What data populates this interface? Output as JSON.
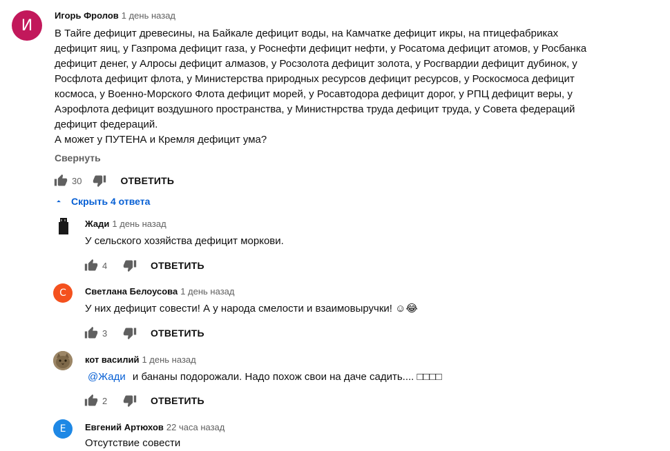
{
  "main_comment": {
    "avatar_letter": "И",
    "avatar_color": "#c2185b",
    "author": "Игорь Фролов",
    "time": "1 день назад",
    "text_lines": [
      "В Тайге дефицит древесины, на Байкале дефицит воды, на Камчатке дефицит икры, на птицефабриках",
      "дефицит яиц, у Газпрома дефицит газа, у Роснефти дефицит нефти, у Росатома дефицит атомов, у Росбанка",
      "дефицит денег, у Алросы дефицит алмазов, у Росзолота дефицит золота, у Росгвардии дефицит дубинок, у",
      "Росфлота дефицит флота, у Министерства природных ресурсов дефицит ресурсов, у Роскосмоса дефицит",
      "космоса, у Военно-Морского Флота дефицит морей, у Росавтодора дефицит дорог, у РПЦ дефицит веры, у",
      "Аэрофлота дефицит воздушного пространства, у Министнрства труда дефицит труда, у Совета федераций",
      "дефицит федераций.",
      "А может у ПУТЕНА и Кремля дефицит ума?"
    ],
    "collapse_label": "Свернуть",
    "likes": "30",
    "reply_label": "ОТВЕТИТЬ"
  },
  "replies_toggle": {
    "label": "Скрыть 4 ответа",
    "icon": "chevron-up-icon"
  },
  "replies": [
    {
      "avatar_type": "image",
      "author": "Жади",
      "time": "1 день назад",
      "mention": "",
      "text": "У сельского хозяйства дефицит моркови.",
      "likes": "4",
      "reply_label": "ОТВЕТИТЬ"
    },
    {
      "avatar_type": "letter",
      "avatar_letter": "С",
      "avatar_color": "#f4511e",
      "author": "Светлана Белоусова",
      "time": "1 день назад",
      "mention": "",
      "text": "У них дефицит совести! А у народа смелости и взаимовыручки! ☺😂",
      "likes": "3",
      "reply_label": "ОТВЕТИТЬ"
    },
    {
      "avatar_type": "cat",
      "author": "кот василий",
      "time": "1 день назад",
      "mention": "@Жади",
      "text": "и бананы подорожали. Надо похож свои на даче садить.... □□□□",
      "likes": "2",
      "reply_label": "ОТВЕТИТЬ"
    },
    {
      "avatar_type": "letter",
      "avatar_letter": "Е",
      "avatar_color": "#1e88e5",
      "author": "Евгений Артюхов",
      "time": "22 часа назад",
      "mention": "",
      "text": "Отсутствие совести"
    }
  ]
}
